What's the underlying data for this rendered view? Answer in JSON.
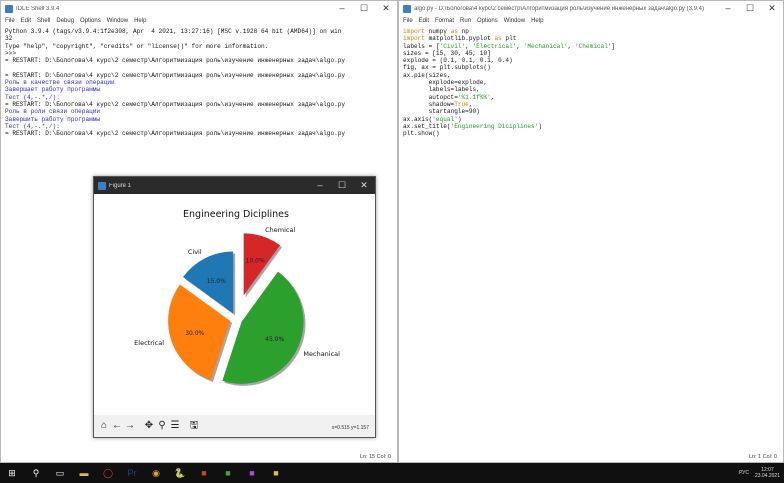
{
  "shell": {
    "title": "IDLE Shell 3.9.4",
    "menu": [
      "File",
      "Edit",
      "Shell",
      "Debug",
      "Options",
      "Window",
      "Help"
    ],
    "lines": [
      {
        "text": "Python 3.9.4 (tags/v3.9.4:1f2e308, Apr  4 2021, 13:27:16) [MSC v.1928 64 bit (AMD64)] on win",
        "cls": ""
      },
      {
        "text": "32",
        "cls": ""
      },
      {
        "text": "Type \"help\", \"copyright\", \"credits\" or \"license()\" for more information.",
        "cls": ""
      },
      {
        "text": ">>>",
        "cls": ""
      },
      {
        "text": "= RESTART: D:\\Бологова\\4 курс\\2 семестр\\Алгоритмизация роль\\изучение инженерных задач\\algo.py",
        "cls": ""
      },
      {
        "text": "",
        "cls": ""
      },
      {
        "text": "= RESTART: D:\\Бологова\\4 курс\\2 семестр\\Алгоритмизация роль\\изучение инженерных задач\\algo.py",
        "cls": ""
      },
      {
        "text": "Роль в качестве связи операции",
        "cls": "c-blue"
      },
      {
        "text": "Завершает работу программы",
        "cls": "c-blue"
      },
      {
        "text": "Тест (4,-.*,/):",
        "cls": "c-blue"
      },
      {
        "text": "= RESTART: D:\\Бологова\\4 курс\\2 семестр\\Алгоритмизация роль\\изучение инженерных задач\\algo.py",
        "cls": ""
      },
      {
        "text": "Роль в роли связи операции",
        "cls": "c-blue"
      },
      {
        "text": "Завершить работу программы",
        "cls": "c-blue"
      },
      {
        "text": "Тест (4,-.*,/):",
        "cls": "c-blue"
      },
      {
        "text": "= RESTART: D:\\Бологова\\4 курс\\2 семестр\\Алгоритмизация роль\\изучение инженерных задач\\algo.py",
        "cls": ""
      }
    ],
    "status": "Ln: 15  Col: 0"
  },
  "editor": {
    "title": "algo.py - D:\\Бологова\\4 курс\\2 семестр\\Алгоритмизация роль\\изучение инженерных задач\\algo.py (3.9.4)",
    "menu": [
      "File",
      "Edit",
      "Format",
      "Run",
      "Options",
      "Window",
      "Help"
    ],
    "lines": [
      [
        {
          "t": "import",
          "c": "c-kw"
        },
        {
          "t": " numpy ",
          "c": ""
        },
        {
          "t": "as",
          "c": "c-kw"
        },
        {
          "t": " np",
          "c": ""
        }
      ],
      [
        {
          "t": "import",
          "c": "c-kw"
        },
        {
          "t": " matplotlib.pyplot ",
          "c": ""
        },
        {
          "t": "as",
          "c": "c-kw"
        },
        {
          "t": " plt",
          "c": ""
        }
      ],
      [
        {
          "t": "labels = [",
          "c": ""
        },
        {
          "t": "'Civil'",
          "c": "c-str"
        },
        {
          "t": ", ",
          "c": ""
        },
        {
          "t": "'Electrical'",
          "c": "c-str"
        },
        {
          "t": ", ",
          "c": ""
        },
        {
          "t": "'Mechanical'",
          "c": "c-str"
        },
        {
          "t": ", ",
          "c": ""
        },
        {
          "t": "'Chemical'",
          "c": "c-str"
        },
        {
          "t": "]",
          "c": ""
        }
      ],
      [
        {
          "t": "sizes = [15, 30, 45, 10]",
          "c": ""
        }
      ],
      [
        {
          "t": "explode = (0.1, 0.1, 0.1, 0.4)",
          "c": ""
        }
      ],
      [
        {
          "t": "fig, ax = plt.subplots()",
          "c": ""
        }
      ],
      [
        {
          "t": "ax.pie(sizes,",
          "c": ""
        }
      ],
      [
        {
          "t": "       explode=explode,",
          "c": ""
        }
      ],
      [
        {
          "t": "       labels=labels,",
          "c": ""
        }
      ],
      [
        {
          "t": "       autopct=",
          "c": ""
        },
        {
          "t": "'%1.1f%%'",
          "c": "c-str"
        },
        {
          "t": ",",
          "c": ""
        }
      ],
      [
        {
          "t": "       shadow=",
          "c": ""
        },
        {
          "t": "True",
          "c": "c-kw"
        },
        {
          "t": ",",
          "c": ""
        }
      ],
      [
        {
          "t": "       startangle=90)",
          "c": ""
        }
      ],
      [
        {
          "t": "ax.axis(",
          "c": ""
        },
        {
          "t": "'equal'",
          "c": "c-str"
        },
        {
          "t": ")",
          "c": ""
        }
      ],
      [
        {
          "t": "ax.set_title(",
          "c": ""
        },
        {
          "t": "'Engineering Diciplines'",
          "c": "c-str"
        },
        {
          "t": ")",
          "c": ""
        }
      ],
      [
        {
          "t": "plt.show()",
          "c": ""
        }
      ]
    ],
    "status": "Ln: 1  Col: 0"
  },
  "figure": {
    "title": "Figure 1",
    "coords": "x=0.515 y=1.157",
    "toolbar": [
      {
        "name": "home-icon",
        "glyph": "⌂"
      },
      {
        "name": "back-icon",
        "glyph": "←"
      },
      {
        "name": "forward-icon",
        "glyph": "→"
      },
      {
        "name": "pan-icon",
        "glyph": "✥"
      },
      {
        "name": "zoom-icon",
        "glyph": "⚲"
      },
      {
        "name": "configure-subplots-icon",
        "glyph": "☰"
      },
      {
        "name": "save-icon",
        "glyph": "🖫"
      }
    ]
  },
  "chart_data": {
    "type": "pie",
    "title": "Engineering Diciplines",
    "categories": [
      "Civil",
      "Electrical",
      "Mechanical",
      "Chemical"
    ],
    "values": [
      15,
      30,
      45,
      10
    ],
    "labels_pct": [
      "15.0%",
      "30.0%",
      "45.0%",
      "10.0%"
    ],
    "explode": [
      0.1,
      0.1,
      0.1,
      0.4
    ],
    "colors": [
      "#1f77b4",
      "#ff7f0e",
      "#2ca02c",
      "#d62728"
    ],
    "startangle": 90,
    "shadow": true
  },
  "taskbar": {
    "icons": [
      "windows-start-icon",
      "search-icon",
      "task-view-icon",
      "file-explorer-icon",
      "opera-icon",
      "premiere-icon",
      "chrome-icon",
      "python-icon",
      "app-icon-1",
      "app-icon-2",
      "app-icon-3",
      "app-icon-4"
    ],
    "lang": "РУС",
    "time": "12:07",
    "date": "23.04.2021"
  }
}
